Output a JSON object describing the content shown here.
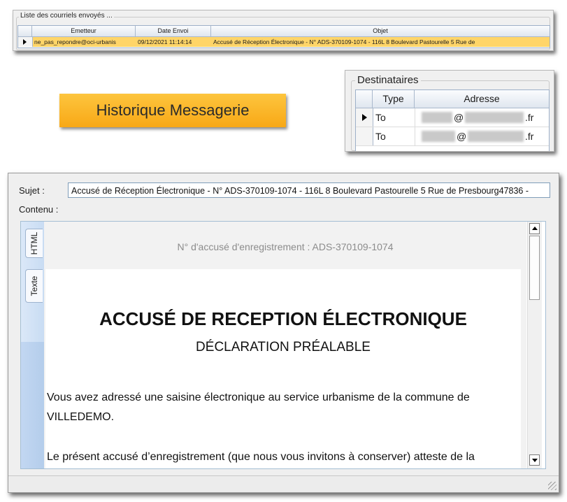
{
  "sent_list": {
    "title": "Liste des courriels envoyés ...",
    "columns": [
      "Emetteur",
      "Date Envoi",
      "Objet"
    ],
    "row": {
      "emetteur": "ne_pas_repondre@oci-urbanis",
      "date": "09/12/2021 11:14:14",
      "objet": "Accusé de Réception Électronique - N° ADS-370109-1074 - 116L 8 Boulevard Pastourelle 5 Rue de"
    }
  },
  "banner": {
    "label": "Historique Messagerie"
  },
  "recipients": {
    "title": "Destinataires",
    "columns": [
      "Type",
      "Adresse"
    ],
    "rows": [
      {
        "type": "To",
        "at": "@",
        "tld": ".fr"
      },
      {
        "type": "To",
        "at": "@",
        "tld": ".fr"
      }
    ]
  },
  "message": {
    "subject_label": "Sujet :",
    "subject": "Accusé de Réception Électronique - N° ADS-370109-1074 - 116L 8 Boulevard Pastourelle 5 Rue de Presbourg47836 -",
    "content_label": "Contenu :",
    "tabs": [
      "HTML",
      "Texte"
    ],
    "body": {
      "ack_number": "N° d'accusé d'enregistrement : ADS-370109-1074",
      "heading": "ACCUSÉ DE RECEPTION ÉLECTRONIQUE",
      "subheading": "DÉCLARATION PRÉALABLE",
      "paragraph1": "Vous avez adressé une saisine électronique au service urbanisme de la commune de VILLEDEMO.",
      "paragraph2": "Le présent accusé d’enregistrement (que nous vous invitons à conserver) atteste de la"
    }
  },
  "colors": {
    "selected_row": "#ffd568",
    "banner": "#f9b52c",
    "tab_strip": "#c8dcf3"
  }
}
